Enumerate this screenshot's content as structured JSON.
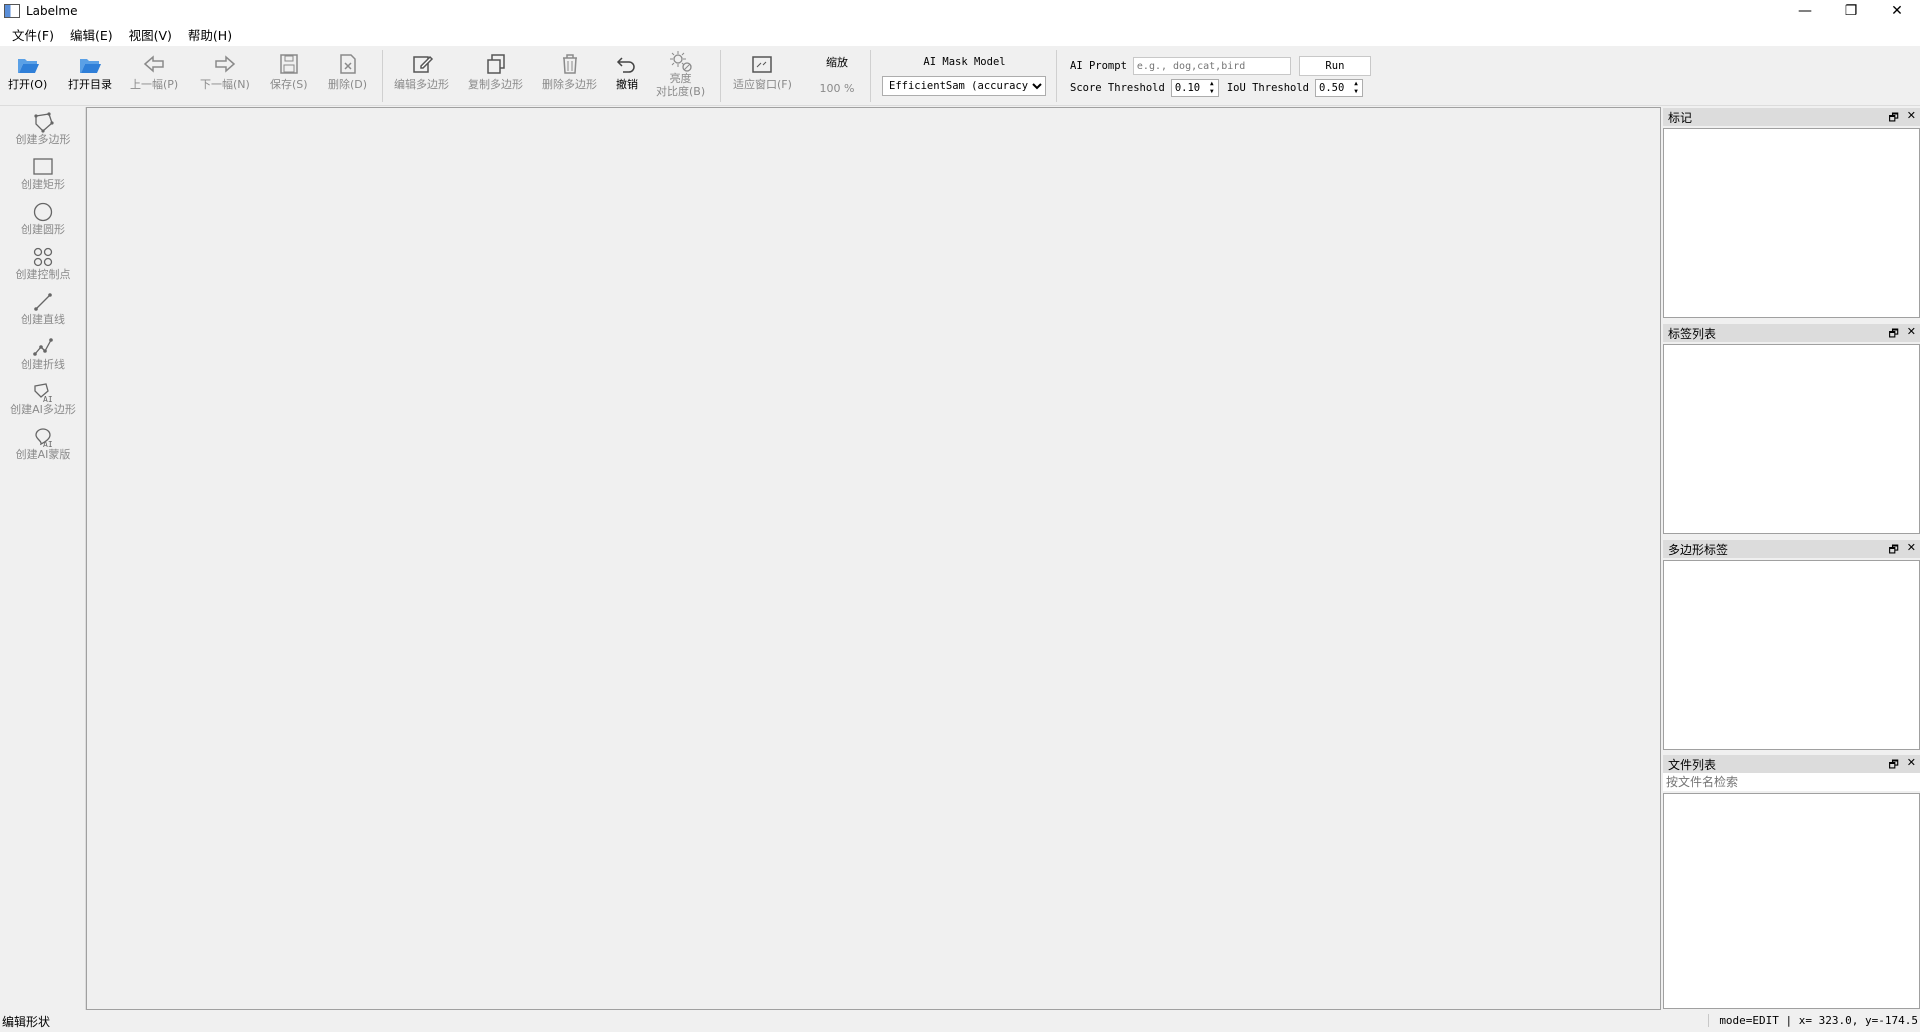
{
  "window": {
    "title": "Labelme",
    "controls": [
      "—",
      "❐",
      "✕"
    ]
  },
  "menu": [
    "文件(F)",
    "编辑(E)",
    "视图(V)",
    "帮助(H)"
  ],
  "toolbar": {
    "open": "打开(O)",
    "open_dir": "打开目录",
    "prev": "上一幅(P)",
    "next": "下一幅(N)",
    "save": "保存(S)",
    "delete_file": "删除(D)",
    "edit_poly": "编辑多边形",
    "copy_poly": "复制多边形",
    "delete_poly": "删除多边形",
    "undo": "撤销",
    "brightness_1": "亮度",
    "brightness_2": "对比度(B)",
    "fit_window": "适应窗口(F)",
    "zoom_label": "缩放",
    "zoom_value": "100 %"
  },
  "ai_mask": {
    "header": "AI Mask Model",
    "selected": "EfficientSam (accuracy)"
  },
  "ai_prompt": {
    "label": "AI Prompt",
    "placeholder": "e.g., dog,cat,bird",
    "run": "Run",
    "score_label": "Score Threshold",
    "score_value": "0.10",
    "iou_label": "IoU Threshold",
    "iou_value": "0.50"
  },
  "left_tools": [
    "创建多边形",
    "创建矩形",
    "创建圆形",
    "创建控制点",
    "创建直线",
    "创建折线",
    "创建AI多边形",
    "创建AI蒙版"
  ],
  "ai_badge": "AI",
  "docks": {
    "flags": "标记",
    "labels": "标签列表",
    "polygons": "多边形标签",
    "files": "文件列表",
    "file_search_placeholder": "按文件名检索"
  },
  "status": {
    "left": "编辑形状",
    "right": "mode=EDIT | x= 323.0, y=-174.5"
  },
  "colors": {
    "accent": "#2f7fd8",
    "disabled": "#8a8a8a"
  }
}
